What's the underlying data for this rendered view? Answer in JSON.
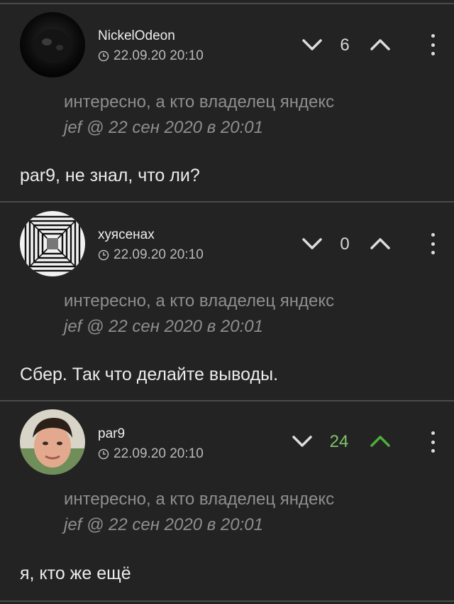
{
  "comments": [
    {
      "username": "NickelOdeon",
      "timestamp": "22.09.20 20:10",
      "votes": "6",
      "quote_text": "интересно, а кто владелец яндекс",
      "quote_author": "jef @ 22 сен 2020 в 20:01",
      "body": "par9, не знал, что ли?"
    },
    {
      "username": "хуясенах",
      "timestamp": "22.09.20 20:10",
      "votes": "0",
      "quote_text": "интересно, а кто владелец яндекс",
      "quote_author": "jef @ 22 сен 2020 в 20:01",
      "body": "Сбер. Так что делайте выводы."
    },
    {
      "username": "par9",
      "timestamp": "22.09.20 20:10",
      "votes": "24",
      "quote_text": "интересно, а кто владелец яндекс",
      "quote_author": "jef @ 22 сен 2020 в 20:01",
      "body": "я, кто же ещё"
    }
  ],
  "colors": {
    "background": "#232323",
    "positive_vote": "#7fc46a",
    "divider": "#4a4a4a"
  },
  "icons": [
    "clock-icon",
    "chevron-down-icon",
    "chevron-up-icon",
    "more-vertical-icon"
  ]
}
